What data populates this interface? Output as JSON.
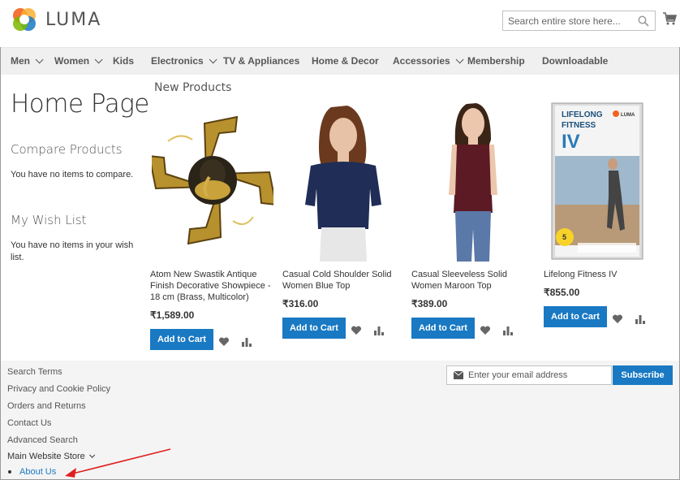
{
  "header": {
    "logo_text": "LUMA",
    "search_placeholder": "Search entire store here...",
    "search_icon": "search-icon",
    "cart_icon": "cart-icon"
  },
  "nav": {
    "items": [
      {
        "label": "Men",
        "has_dropdown": true
      },
      {
        "label": "Women",
        "has_dropdown": true
      },
      {
        "label": "Kids",
        "has_dropdown": false
      },
      {
        "label": "Electronics",
        "has_dropdown": true
      },
      {
        "label": "TV & Appliances",
        "has_dropdown": false
      },
      {
        "label": "Home & Decor",
        "has_dropdown": false
      },
      {
        "label": "Accessories",
        "has_dropdown": true
      },
      {
        "label": "Membership",
        "has_dropdown": false
      },
      {
        "label": "Downloadable",
        "has_dropdown": false
      }
    ]
  },
  "sidebar": {
    "page_title": "Home Page",
    "compare": {
      "title": "Compare Products",
      "text": "You have no items to compare."
    },
    "wishlist": {
      "title": "My Wish List",
      "text": "You have no items in your wish list."
    }
  },
  "products": {
    "section_title": "New Products",
    "items": [
      {
        "name": "Atom New Swastik Antique Finish Decorative Showpiece - 18 cm (Brass, Multicolor)",
        "price": "₹1,589.00",
        "add_label": "Add to Cart"
      },
      {
        "name": "Casual Cold Shoulder Solid Women Blue Top",
        "price": "₹316.00",
        "add_label": "Add to Cart"
      },
      {
        "name": "Casual Sleeveless Solid Women Maroon Top",
        "price": "₹389.00",
        "add_label": "Add to Cart"
      },
      {
        "name": "Lifelong Fitness IV",
        "price": "₹855.00",
        "add_label": "Add to Cart"
      }
    ],
    "dvd_cover": {
      "title_line1": "LIFELONG",
      "title_line2": "FITNESS",
      "title_line3": "IV",
      "brand": "LUMA",
      "badge_number": "5"
    }
  },
  "footer": {
    "links": [
      "Search Terms",
      "Privacy and Cookie Policy",
      "Orders and Returns",
      "Contact Us",
      "Advanced Search"
    ],
    "store_switcher": "Main Website Store",
    "about_link": "About Us",
    "newsletter_placeholder": "Enter your email address",
    "subscribe_label": "Subscribe"
  },
  "colors": {
    "accent": "#1979c3",
    "nav_bg": "#f0f0f0",
    "footer_bg": "#f4f4f4",
    "annotation_arrow": "#e02020"
  }
}
